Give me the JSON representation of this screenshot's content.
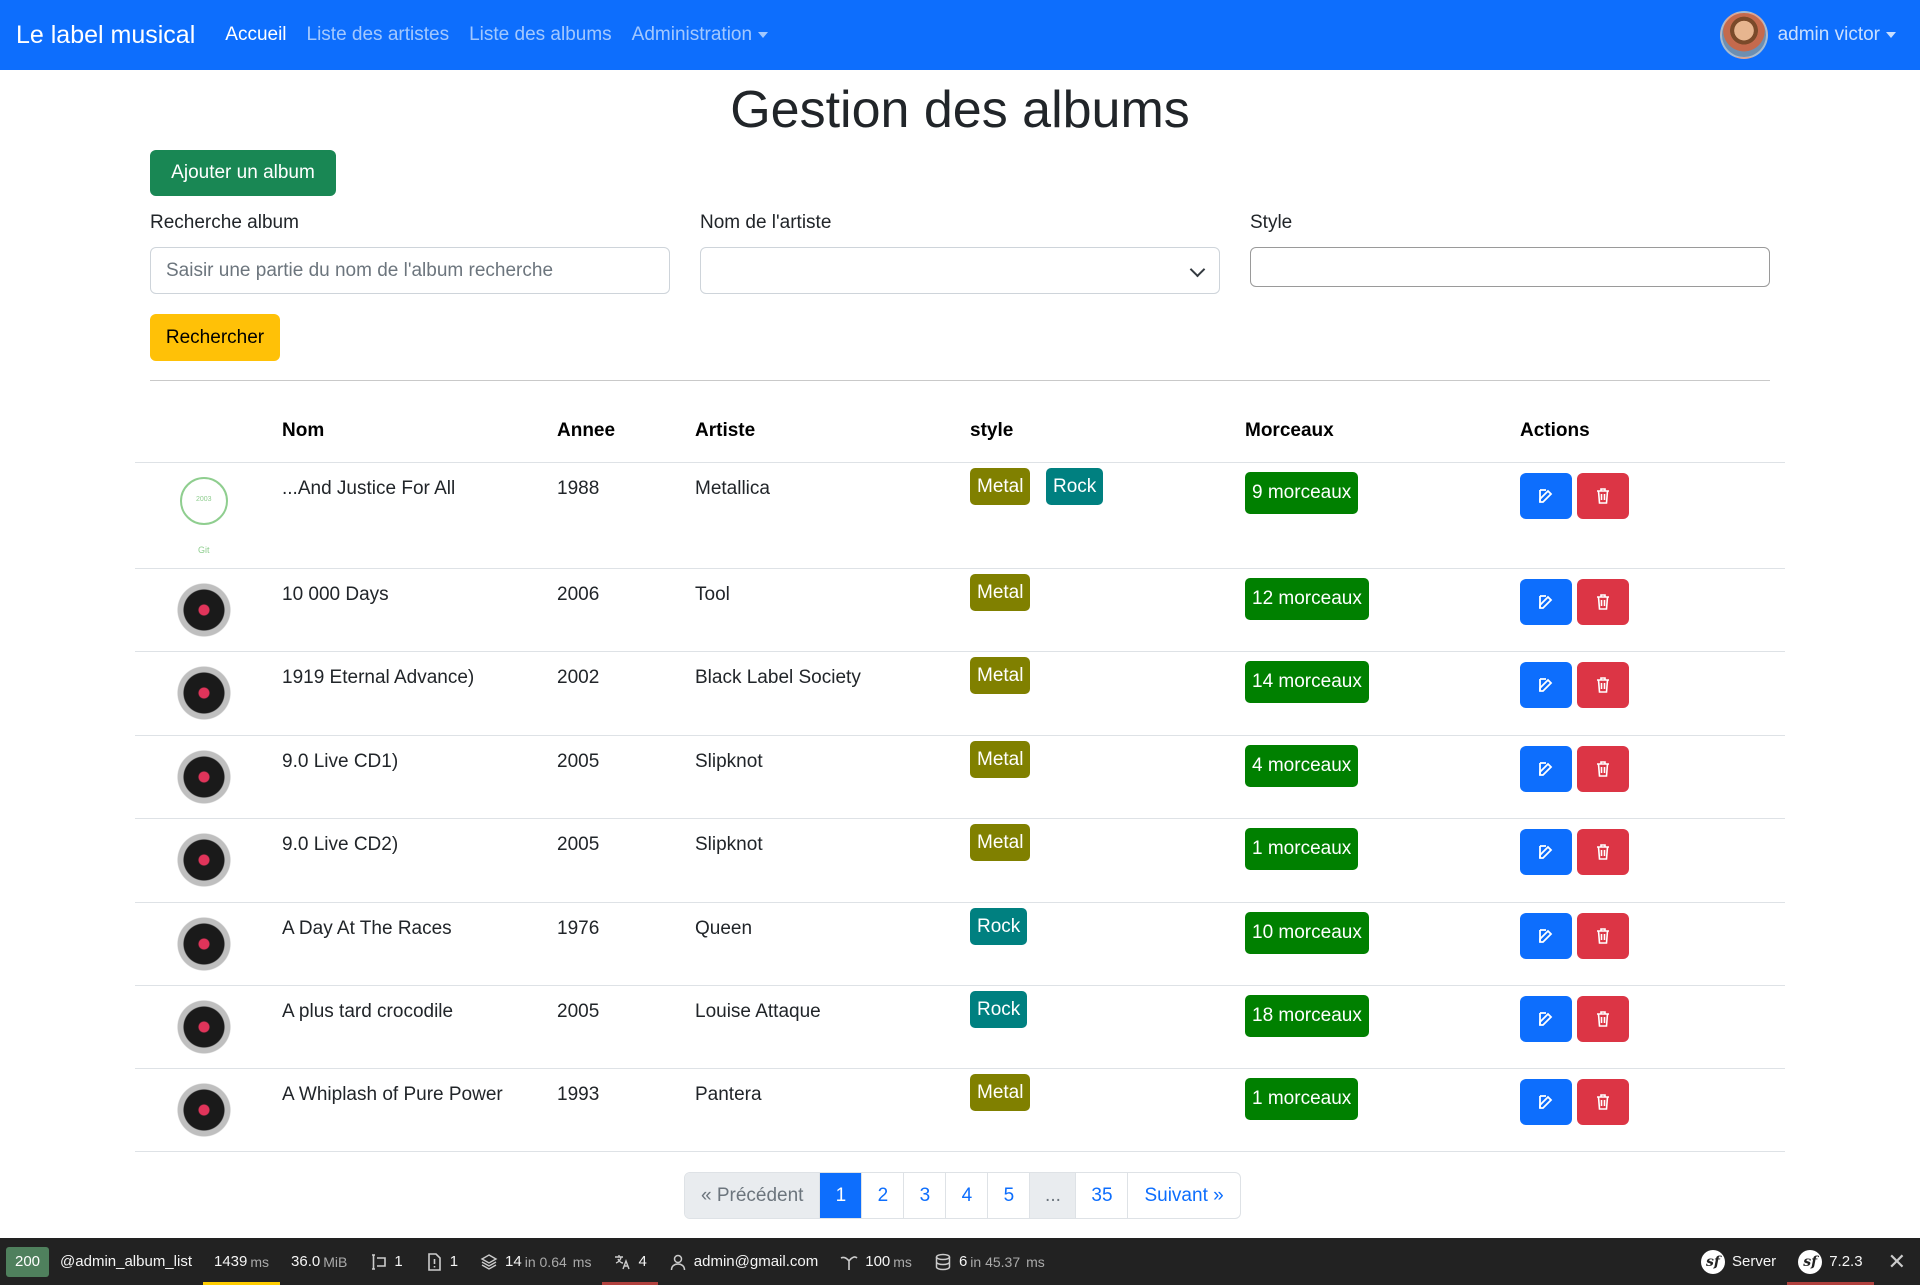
{
  "navbar": {
    "brand": "Le label musical",
    "links": [
      "Accueil",
      "Liste des artistes",
      "Liste des albums",
      "Administration"
    ],
    "user": "admin victor"
  },
  "page": {
    "title": "Gestion des albums",
    "add_button": "Ajouter un album",
    "search_button": "Rechercher"
  },
  "filters": {
    "album_label": "Recherche album",
    "album_placeholder": "Saisir une partie du nom de l'album recherche",
    "artist_label": "Nom de l'artiste",
    "artist_value": "",
    "style_label": "Style",
    "style_value": ""
  },
  "table": {
    "columns": [
      "Nom",
      "Annee",
      "Artiste",
      "style",
      "Morceaux",
      "Actions"
    ],
    "rows": [
      {
        "cover": "git-cover",
        "cover_year": "2003",
        "cover_text": "Git",
        "nom": "...And Justice For All",
        "annee": "1988",
        "artiste": "Metallica",
        "styles": [
          "Metal",
          "Rock"
        ],
        "morceaux": "9 morceaux"
      },
      {
        "cover": "vinyl",
        "nom": "10 000 Days",
        "annee": "2006",
        "artiste": "Tool",
        "styles": [
          "Metal"
        ],
        "morceaux": "12 morceaux"
      },
      {
        "cover": "vinyl",
        "nom": "1919 Eternal Advance)",
        "annee": "2002",
        "artiste": "Black Label Society",
        "styles": [
          "Metal"
        ],
        "morceaux": "14 morceaux"
      },
      {
        "cover": "vinyl",
        "nom": "9.0 Live CD1)",
        "annee": "2005",
        "artiste": "Slipknot",
        "styles": [
          "Metal"
        ],
        "morceaux": "4 morceaux"
      },
      {
        "cover": "vinyl",
        "nom": "9.0 Live CD2)",
        "annee": "2005",
        "artiste": "Slipknot",
        "styles": [
          "Metal"
        ],
        "morceaux": "1 morceaux"
      },
      {
        "cover": "vinyl",
        "nom": "A Day At The Races",
        "annee": "1976",
        "artiste": "Queen",
        "styles": [
          "Rock"
        ],
        "morceaux": "10 morceaux"
      },
      {
        "cover": "vinyl",
        "nom": "A plus tard crocodile",
        "annee": "2005",
        "artiste": "Louise Attaque",
        "styles": [
          "Rock"
        ],
        "morceaux": "18 morceaux"
      },
      {
        "cover": "vinyl",
        "nom": "A Whiplash of Pure Power",
        "annee": "1993",
        "artiste": "Pantera",
        "styles": [
          "Metal"
        ],
        "morceaux": "1 morceaux"
      }
    ]
  },
  "pagination": {
    "prev": "« Précédent",
    "pages": [
      "1",
      "2",
      "3",
      "4",
      "5",
      "...",
      "35"
    ],
    "active": "1",
    "next": "Suivant »"
  },
  "debug_toolbar": {
    "status": "200",
    "route": "@admin_album_list",
    "time": "1439",
    "time_unit": "ms",
    "memory": "36.0",
    "memory_unit": "MiB",
    "forms": "1",
    "logs": "1",
    "cache": "14",
    "cache_detail": "in 0.64",
    "cache_unit": "ms",
    "translations": "4",
    "user": "admin@gmail.com",
    "twig": "100",
    "twig_unit": "ms",
    "db": "6",
    "db_detail": "in 45.37",
    "db_unit": "ms",
    "server": "Server",
    "version": "7.2.3"
  },
  "colors": {
    "primary": "#0d6efd",
    "success": "#198754",
    "warning": "#ffc107",
    "danger": "#dc3545",
    "metal": "#808000",
    "rock": "#008080",
    "morceaux": "#008000"
  }
}
